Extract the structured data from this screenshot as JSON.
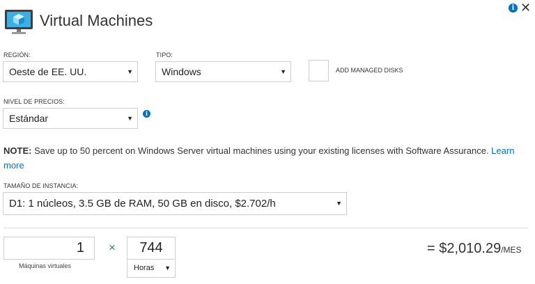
{
  "header": {
    "title": "Virtual Machines",
    "icon": "virtual-machine-icon"
  },
  "top_icons": {
    "info": "i",
    "close": "✕"
  },
  "region": {
    "label": "REGIÓN:",
    "value": "Oeste de EE. UU."
  },
  "tipo": {
    "label": "TIPO:",
    "value": "Windows"
  },
  "managed_disks": {
    "label": "ADD MANAGED DISKS",
    "checked": false
  },
  "pricing": {
    "label": "NIVEL DE PRECIOS:",
    "value": "Estándar",
    "info": "i"
  },
  "note": {
    "prefix": "NOTE:",
    "text": " Save up to 50 percent on Windows Server virtual machines using your existing licenses with Software Assurance. ",
    "link": "Learn more"
  },
  "instance": {
    "label": "TAMAÑO DE INSTANCIA:",
    "value": "D1: 1 núcleos, 3.5 GB de RAM, 50 GB en disco, $2.702/h"
  },
  "calc": {
    "quantity": "1",
    "quantity_caption": "Máquinas virtuales",
    "times": "×",
    "hours": "744",
    "hours_unit": "Horas",
    "total": "= $2,010.29",
    "total_unit": "/MES"
  },
  "colors": {
    "accent": "#0072c6",
    "multiply": "#2e8b57"
  }
}
